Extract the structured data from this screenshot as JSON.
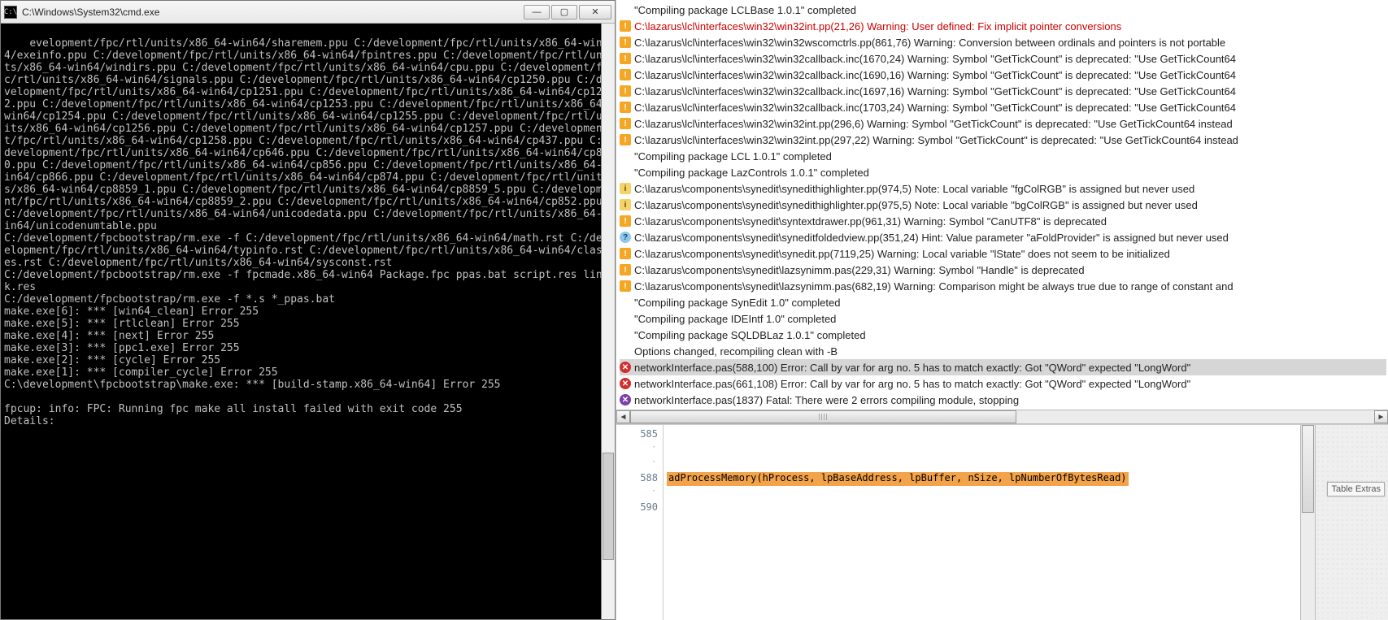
{
  "cmd": {
    "title": "C:\\Windows\\System32\\cmd.exe",
    "icon_text": "C:\\",
    "content": "evelopment/fpc/rtl/units/x86_64-win64/sharemem.ppu C:/development/fpc/rtl/units/x86_64-win64/exeinfo.ppu C:/development/fpc/rtl/units/x86_64-win64/fpintres.ppu C:/development/fpc/rtl/units/x86_64-win64/windirs.ppu C:/development/fpc/rtl/units/x86_64-win64/cpu.ppu C:/development/fpc/rtl/units/x86_64-win64/signals.ppu C:/development/fpc/rtl/units/x86_64-win64/cp1250.ppu C:/development/fpc/rtl/units/x86_64-win64/cp1251.ppu C:/development/fpc/rtl/units/x86_64-win64/cp1252.ppu C:/development/fpc/rtl/units/x86_64-win64/cp1253.ppu C:/development/fpc/rtl/units/x86_64-win64/cp1254.ppu C:/development/fpc/rtl/units/x86_64-win64/cp1255.ppu C:/development/fpc/rtl/units/x86_64-win64/cp1256.ppu C:/development/fpc/rtl/units/x86_64-win64/cp1257.ppu C:/development/fpc/rtl/units/x86_64-win64/cp1258.ppu C:/development/fpc/rtl/units/x86_64-win64/cp437.ppu C:/development/fpc/rtl/units/x86_64-win64/cp646.ppu C:/development/fpc/rtl/units/x86_64-win64/cp850.ppu C:/development/fpc/rtl/units/x86_64-win64/cp856.ppu C:/development/fpc/rtl/units/x86_64-win64/cp866.ppu C:/development/fpc/rtl/units/x86_64-win64/cp874.ppu C:/development/fpc/rtl/units/x86_64-win64/cp8859_1.ppu C:/development/fpc/rtl/units/x86_64-win64/cp8859_5.ppu C:/development/fpc/rtl/units/x86_64-win64/cp8859_2.ppu C:/development/fpc/rtl/units/x86_64-win64/cp852.ppu C:/development/fpc/rtl/units/x86_64-win64/unicodedata.ppu C:/development/fpc/rtl/units/x86_64-win64/unicodenumtable.ppu\nC:/development/fpcbootstrap/rm.exe -f C:/development/fpc/rtl/units/x86_64-win64/math.rst C:/development/fpc/rtl/units/x86_64-win64/typinfo.rst C:/development/fpc/rtl/units/x86_64-win64/classes.rst C:/development/fpc/rtl/units/x86_64-win64/sysconst.rst\nC:/development/fpcbootstrap/rm.exe -f fpcmade.x86_64-win64 Package.fpc ppas.bat script.res link.res\nC:/development/fpcbootstrap/rm.exe -f *.s *_ppas.bat\nmake.exe[6]: *** [win64_clean] Error 255\nmake.exe[5]: *** [rtlclean] Error 255\nmake.exe[4]: *** [next] Error 255\nmake.exe[3]: *** [ppc1.exe] Error 255\nmake.exe[2]: *** [cycle] Error 255\nmake.exe[1]: *** [compiler_cycle] Error 255\nC:\\development\\fpcbootstrap\\make.exe: *** [build-stamp.x86_64-win64] Error 255\n\nfpcup: info: FPC: Running fpc make all install failed with exit code 255\nDetails:"
  },
  "messages": [
    {
      "icon": "none",
      "text": "\"Compiling package LCLBase 1.0.1\" completed"
    },
    {
      "icon": "warn",
      "red": true,
      "text": "C:\\lazarus\\lcl\\interfaces\\win32\\win32int.pp(21,26) Warning: User defined: Fix implicit pointer conversions"
    },
    {
      "icon": "warn",
      "text": "C:\\lazarus\\lcl\\interfaces\\win32\\win32wscomctrls.pp(861,76) Warning: Conversion between ordinals and pointers is not portable"
    },
    {
      "icon": "warn",
      "text": "C:\\lazarus\\lcl\\interfaces\\win32\\win32callback.inc(1670,24) Warning: Symbol \"GetTickCount\" is deprecated: \"Use GetTickCount64"
    },
    {
      "icon": "warn",
      "text": "C:\\lazarus\\lcl\\interfaces\\win32\\win32callback.inc(1690,16) Warning: Symbol \"GetTickCount\" is deprecated: \"Use GetTickCount64"
    },
    {
      "icon": "warn",
      "text": "C:\\lazarus\\lcl\\interfaces\\win32\\win32callback.inc(1697,16) Warning: Symbol \"GetTickCount\" is deprecated: \"Use GetTickCount64"
    },
    {
      "icon": "warn",
      "text": "C:\\lazarus\\lcl\\interfaces\\win32\\win32callback.inc(1703,24) Warning: Symbol \"GetTickCount\" is deprecated: \"Use GetTickCount64"
    },
    {
      "icon": "warn",
      "text": "C:\\lazarus\\lcl\\interfaces\\win32\\win32int.pp(296,6) Warning: Symbol \"GetTickCount\" is deprecated: \"Use GetTickCount64 instead"
    },
    {
      "icon": "warn",
      "text": "C:\\lazarus\\lcl\\interfaces\\win32\\win32int.pp(297,22) Warning: Symbol \"GetTickCount\" is deprecated: \"Use GetTickCount64 instead"
    },
    {
      "icon": "none",
      "text": "\"Compiling package LCL 1.0.1\" completed"
    },
    {
      "icon": "none",
      "text": "\"Compiling package LazControls 1.0.1\" completed"
    },
    {
      "icon": "note",
      "text": "C:\\lazarus\\components\\synedit\\synedithighlighter.pp(974,5) Note: Local variable \"fgColRGB\" is assigned but never used"
    },
    {
      "icon": "note",
      "text": "C:\\lazarus\\components\\synedit\\synedithighlighter.pp(975,5) Note: Local variable \"bgColRGB\" is assigned but never used"
    },
    {
      "icon": "warn",
      "text": "C:\\lazarus\\components\\synedit\\syntextdrawer.pp(961,31) Warning: Symbol \"CanUTF8\" is deprecated"
    },
    {
      "icon": "hint",
      "text": "C:\\lazarus\\components\\synedit\\syneditfoldedview.pp(351,24) Hint: Value parameter \"aFoldProvider\" is assigned but never used"
    },
    {
      "icon": "warn",
      "text": "C:\\lazarus\\components\\synedit\\synedit.pp(7119,25) Warning: Local variable \"lState\" does not seem to be initialized"
    },
    {
      "icon": "warn",
      "text": "C:\\lazarus\\components\\synedit\\lazsynimm.pas(229,31) Warning: Symbol \"Handle\" is deprecated"
    },
    {
      "icon": "warn",
      "text": "C:\\lazarus\\components\\synedit\\lazsynimm.pas(682,19) Warning: Comparison might be always true due to range of constant and"
    },
    {
      "icon": "none",
      "text": "\"Compiling package SynEdit 1.0\" completed"
    },
    {
      "icon": "none",
      "text": "\"Compiling package IDEIntf 1.0\" completed"
    },
    {
      "icon": "none",
      "text": "\"Compiling package SQLDBLaz 1.0.1\" completed"
    },
    {
      "icon": "none",
      "text": "Options changed, recompiling clean with -B"
    },
    {
      "icon": "err",
      "sel": true,
      "text": "networkInterface.pas(588,100) Error: Call by var for arg no. 5 has to match exactly: Got \"QWord\" expected \"LongWord\""
    },
    {
      "icon": "err",
      "text": "networkInterface.pas(661,108) Error: Call by var for arg no. 5 has to match exactly: Got \"QWord\" expected \"LongWord\""
    },
    {
      "icon": "fatal",
      "text": "networkInterface.pas(1837) Fatal: There were 2 errors compiling module, stopping"
    }
  ],
  "editor": {
    "lines": [
      {
        "num": "585",
        "code": ""
      },
      {
        "num": ".",
        "code": ""
      },
      {
        "num": ".",
        "code": ""
      },
      {
        "num": "588",
        "code": "adProcessMemory(hProcess, lpBaseAddress, lpBuffer, nSize, lpNumberOfBytesRead)",
        "hl": true
      },
      {
        "num": ".",
        "code": ""
      },
      {
        "num": "590",
        "code": ""
      }
    ],
    "side_tab": "Table Extras"
  }
}
